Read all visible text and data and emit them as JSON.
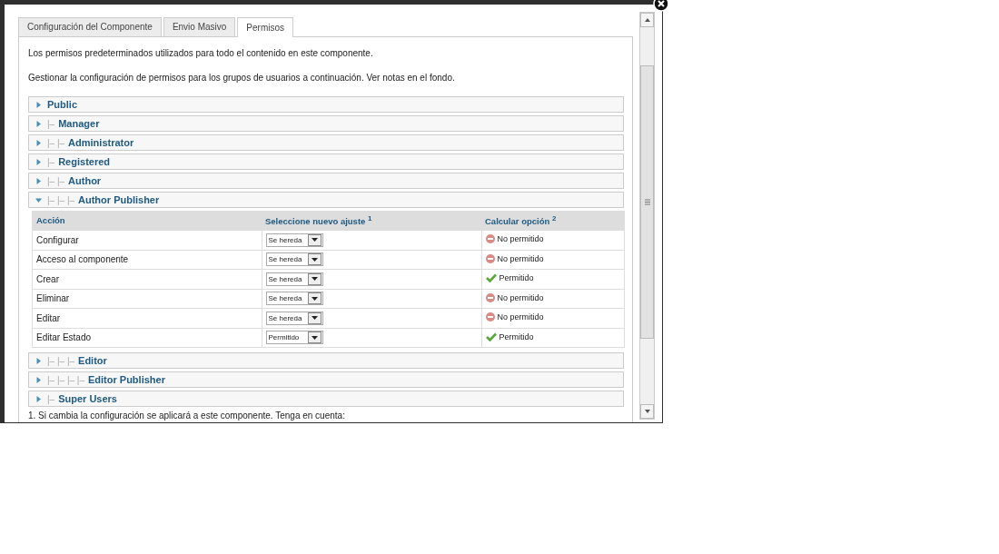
{
  "tabs": [
    {
      "label": "Configuración del Componente",
      "selected": false
    },
    {
      "label": "Envio Masivo",
      "selected": false
    },
    {
      "label": "Permisos",
      "selected": true
    }
  ],
  "intro": [
    "Los permisos predeterminados utilizados para todo el contenido en este componente.",
    "Gestionar la configuración de permisos para los grupos de usuarios a continuación. Ver notas en el fondo."
  ],
  "groups": [
    {
      "name": "Public",
      "expanded": false
    },
    {
      "prefix": "|–",
      "name": "Manager",
      "expanded": false
    },
    {
      "prefix": "|– |–",
      "name": "Administrator",
      "expanded": false
    },
    {
      "prefix": "|–",
      "name": "Registered",
      "expanded": false
    },
    {
      "prefix": "|– |–",
      "name": "Author",
      "expanded": false
    },
    {
      "prefix": "|– |– |–",
      "name": "Author Publisher",
      "expanded": true,
      "table": {
        "columns": [
          "Acción",
          "Seleccione nuevo ajuste $^{1}$",
          "Calcular opción $^{2}$"
        ],
        "rows": [
          {
            "action": "Configurar",
            "setting": "Se hereda",
            "result": "No permitido",
            "kind": "denied"
          },
          {
            "action": "Acceso al componente",
            "setting": "Se hereda",
            "result": "No permitido",
            "kind": "denied"
          },
          {
            "action": "Crear",
            "setting": "Se hereda",
            "result": "Permitido",
            "kind": "allowed"
          },
          {
            "action": "Eliminar",
            "setting": "Se hereda",
            "result": "No permitido",
            "kind": "denied"
          },
          {
            "action": "Editar",
            "setting": "Se hereda",
            "result": "No permitido",
            "kind": "denied"
          },
          {
            "action": "Editar Estado",
            "setting": "Permitido",
            "result": "Permitido",
            "kind": "allowed"
          }
        ]
      }
    },
    {
      "prefix": "|– |– |–",
      "name": "Editor",
      "expanded": false
    },
    {
      "prefix": "|– |– |– |–",
      "name": "Editor Publisher",
      "expanded": false
    },
    {
      "prefix": "|–",
      "name": "Super Users",
      "expanded": false
    }
  ],
  "note": "1. Si cambia la configuración se aplicará a este componente. Tenga en cuenta:"
}
